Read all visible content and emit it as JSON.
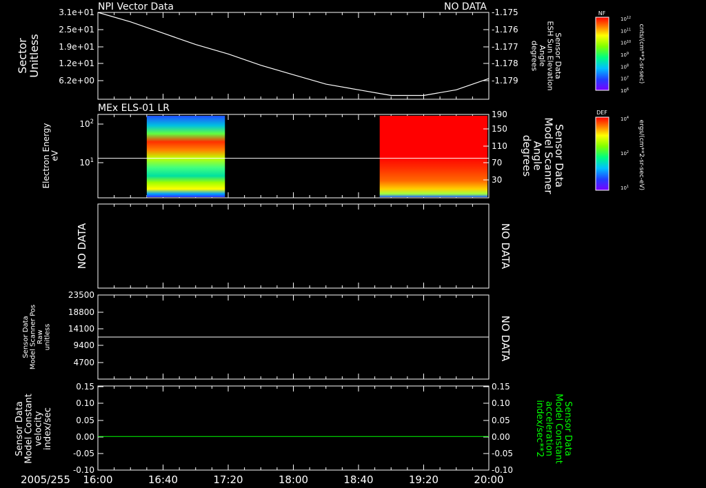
{
  "colors": {
    "background": "#000000",
    "foreground": "#ffffff",
    "green_trace": "#00ff00"
  },
  "date_label": "2005/255",
  "time_axis": {
    "start": "16:00",
    "end": "20:00",
    "ticks": [
      "16:00",
      "16:40",
      "17:20",
      "18:00",
      "18:40",
      "19:20",
      "20:00"
    ]
  },
  "chart_data": [
    {
      "type": "line",
      "title": "NPI Vector Data",
      "right_title": "NO DATA",
      "ylabel": "Sector Unitless",
      "yticks": [
        "3.1e+01",
        "2.5e+01",
        "1.9e+01",
        "1.2e+01",
        "6.2e+00"
      ],
      "ylim": [
        0,
        31
      ],
      "y2label": "Sensor Data ESH Sun Elevation Angle degrees",
      "y2ticks": [
        "-1.175",
        "-1.176",
        "-1.177",
        "-1.178",
        "-1.179"
      ],
      "y2lim": [
        -1.1796,
        -1.175
      ],
      "series": [
        {
          "axis": "right",
          "x": [
            "16:00",
            "16:20",
            "16:40",
            "17:00",
            "17:20",
            "17:40",
            "18:00",
            "18:20",
            "18:40",
            "19:00",
            "19:20",
            "19:40",
            "20:00"
          ],
          "values": [
            -1.175,
            -1.1755,
            -1.1761,
            -1.1767,
            -1.1772,
            -1.1778,
            -1.1783,
            -1.1788,
            -1.1791,
            -1.1794,
            -1.1794,
            -1.1791,
            -1.1785
          ]
        }
      ],
      "grid": false
    },
    {
      "type": "heatmap",
      "title": "MEx ELS-01 LR",
      "ylabel": "Electron Energy eV",
      "yscale": "log",
      "ylim": [
        1,
        200
      ],
      "yticks": [
        "10^2",
        "10^1"
      ],
      "y2label": "Sensor Data Model Scanner Angle degrees",
      "y2ticks": [
        "190",
        "150",
        "110",
        "70",
        "30"
      ],
      "y2lim": [
        0,
        190
      ],
      "data_blocks": [
        {
          "start": "16:30",
          "end": "17:18",
          "description": "band"
        },
        {
          "start": "18:53",
          "end": "20:00",
          "description": "saturated"
        }
      ],
      "scanner_angle_line": 90,
      "colorbar": {
        "label": "DEF",
        "unit": "ergs/(cm**2-sr-sec-eV)",
        "ticks": [
          "10^4",
          "10^2",
          "10^1"
        ]
      }
    },
    {
      "type": "line",
      "ylabel": "NO DATA",
      "right_title": "NO DATA",
      "series": []
    },
    {
      "type": "line",
      "ylabel": "Sensor Data Model Scanner Pos Raw unitless",
      "yticks": [
        "23500",
        "18800",
        "14100",
        "9400",
        "4700"
      ],
      "ylim": [
        0,
        23500
      ],
      "right_title": "NO DATA",
      "series": [
        {
          "x": [
            "16:00",
            "20:00"
          ],
          "values": [
            11750,
            11750
          ]
        }
      ]
    },
    {
      "type": "line",
      "ylabel": "Sensor Data Model Constant velocity index/sec",
      "yticks": [
        "0.15",
        "0.10",
        "0.05",
        "0.00",
        "-0.05",
        "-0.10"
      ],
      "ylim": [
        -0.1,
        0.15
      ],
      "y2label": "Sensor Data Model Constant acceleration index/sec**2",
      "y2ticks": [
        "0.15",
        "0.10",
        "0.05",
        "0.00",
        "-0.05",
        "-0.10"
      ],
      "y2lim": [
        -0.1,
        0.15
      ],
      "series": [
        {
          "x": [
            "16:00",
            "20:00"
          ],
          "values": [
            0.0,
            0.0
          ]
        }
      ]
    }
  ],
  "colorbar_top": {
    "label": "NF",
    "unit": "cnts/(cm**2-sr-sec)",
    "ticks": [
      "10^12",
      "10^11",
      "10^10",
      "10^9",
      "10^8",
      "10^7",
      "10^6"
    ]
  },
  "labels": {
    "p1_left": [
      "Sector",
      "Unitless"
    ],
    "p1_right": [
      "Sensor Data",
      "ESH Sun Elevation",
      "Angle",
      "degrees"
    ],
    "p2_left": [
      "Electron Energy",
      "eV"
    ],
    "p2_right": [
      "Sensor Data",
      "Model Scanner",
      "Angle",
      "degrees"
    ],
    "p3_left": "NO DATA",
    "p3_right": "NO DATA",
    "p4_left": [
      "Sensor Data",
      "Model Scanner Pos",
      "Raw",
      "unitless"
    ],
    "p4_right": "NO DATA",
    "p5_left": [
      "Sensor Data",
      "Model Constant",
      "velocity",
      "index/sec"
    ],
    "p5_right": [
      "Sensor Data",
      "Model Constant",
      "acceleration",
      "index/sec**2"
    ]
  }
}
